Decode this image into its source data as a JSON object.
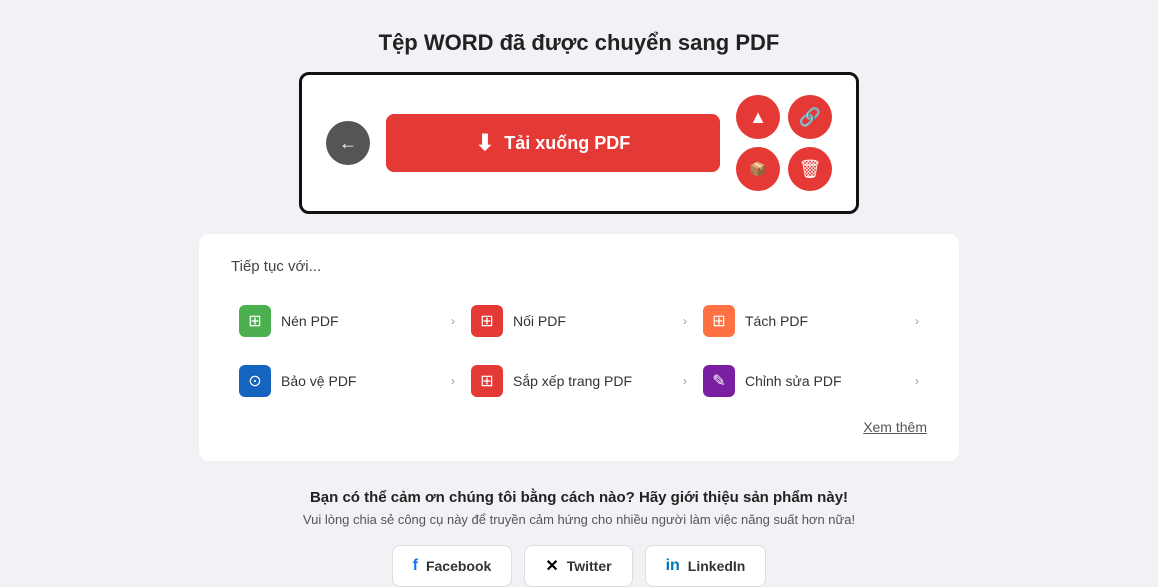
{
  "page": {
    "title": "Tệp WORD đã được chuyển sang PDF"
  },
  "actionBox": {
    "back_label": "←",
    "download_label": "Tải xuống PDF",
    "upload_icon": "▲",
    "link_icon": "🔗",
    "dropbox_icon": "◆",
    "delete_icon": "🗑"
  },
  "continueSection": {
    "title": "Tiếp tục với...",
    "see_more": "Xem thêm",
    "tools": [
      {
        "label": "Nén PDF",
        "icon_type": "green",
        "icon": "⊞"
      },
      {
        "label": "Nối PDF",
        "icon_type": "red",
        "icon": "⊞"
      },
      {
        "label": "Tách PDF",
        "icon_type": "orange",
        "icon": "⊞"
      },
      {
        "label": "Bảo vệ PDF",
        "icon_type": "blue",
        "icon": "⊙"
      },
      {
        "label": "Sắp xếp trang PDF",
        "icon_type": "red",
        "icon": "⊞"
      },
      {
        "label": "Chỉnh sửa PDF",
        "icon_type": "purple",
        "icon": "✎"
      }
    ]
  },
  "shareSection": {
    "title": "Bạn có thể cảm ơn chúng tôi bằng cách nào? Hãy giới thiệu sản phẩm này!",
    "subtitle": "Vui lòng chia sẻ công cụ này để truyền cảm hứng cho nhiều người làm việc năng suất hơn nữa!",
    "facebook_label": "Facebook",
    "twitter_label": "Twitter",
    "linkedin_label": "LinkedIn"
  }
}
